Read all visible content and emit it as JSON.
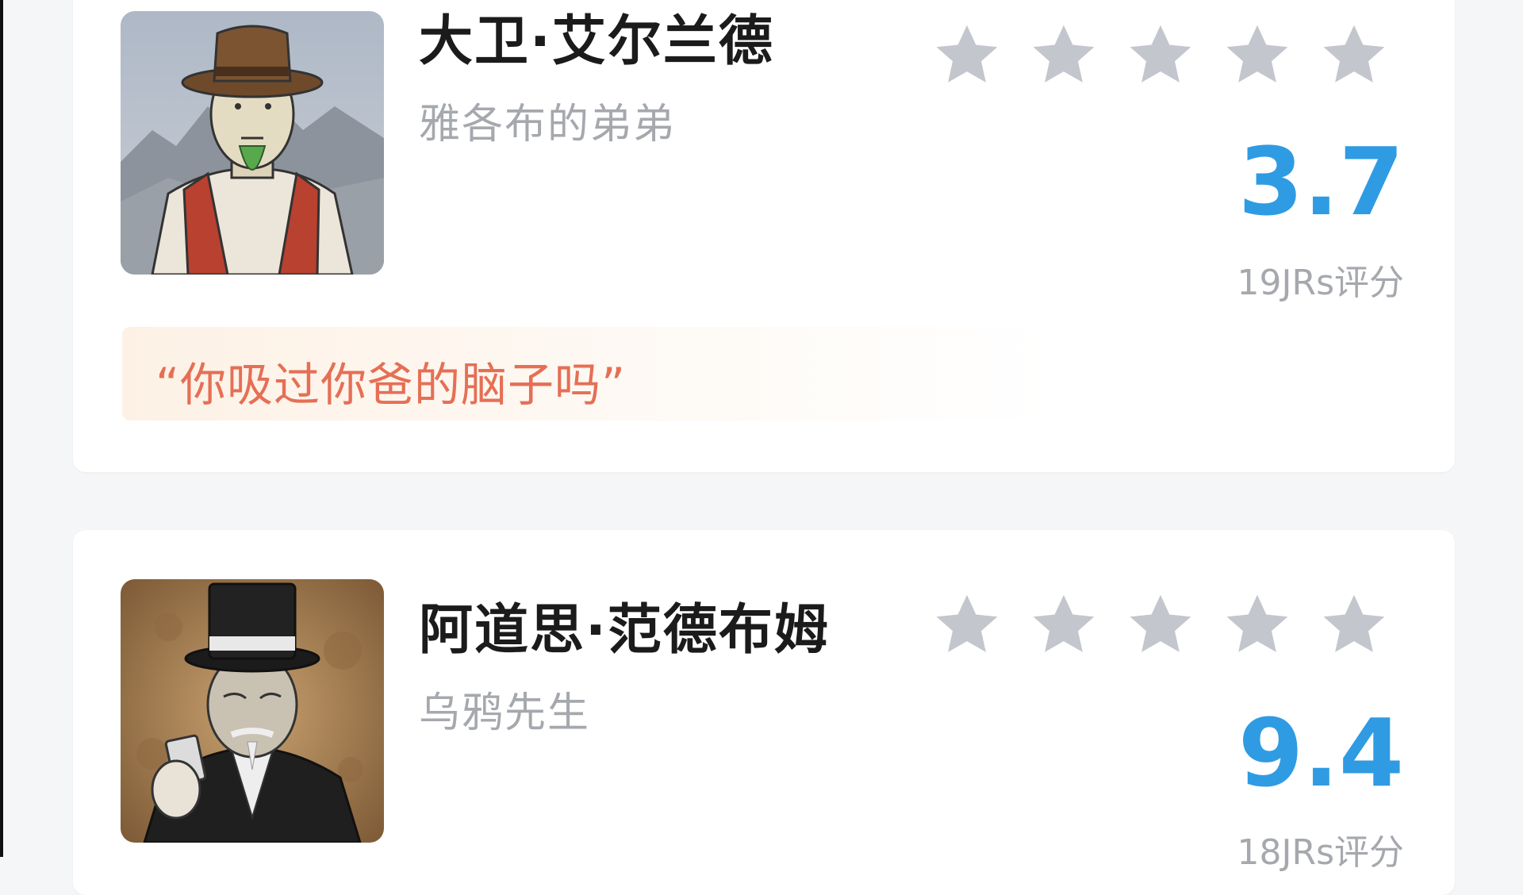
{
  "reviews": [
    {
      "name": "大卫·艾尔兰德",
      "subtitle": "雅各布的弟弟",
      "stars_filled": 0,
      "stars_total": 5,
      "score": "3.7",
      "rating_count": "19JRs评分",
      "quote": "“你吸过你爸的脑子吗”"
    },
    {
      "name": "阿道思·范德布姆",
      "subtitle": "乌鸦先生",
      "stars_filled": 0,
      "stars_total": 5,
      "score": "9.4",
      "rating_count": "18JRs评分"
    }
  ],
  "colors": {
    "background": "#f5f6f8",
    "card": "#ffffff",
    "name": "#1b1b1b",
    "subtitle": "#a5a8ad",
    "star_empty": "#c4c6ce",
    "score": "#2f9be3",
    "quote_text": "#e56f55",
    "quote_bg": "#fdf1e5"
  },
  "icons": {
    "star": "star-icon",
    "avatar_1": "character-portrait-cowboy-hat",
    "avatar_2": "character-portrait-top-hat"
  }
}
